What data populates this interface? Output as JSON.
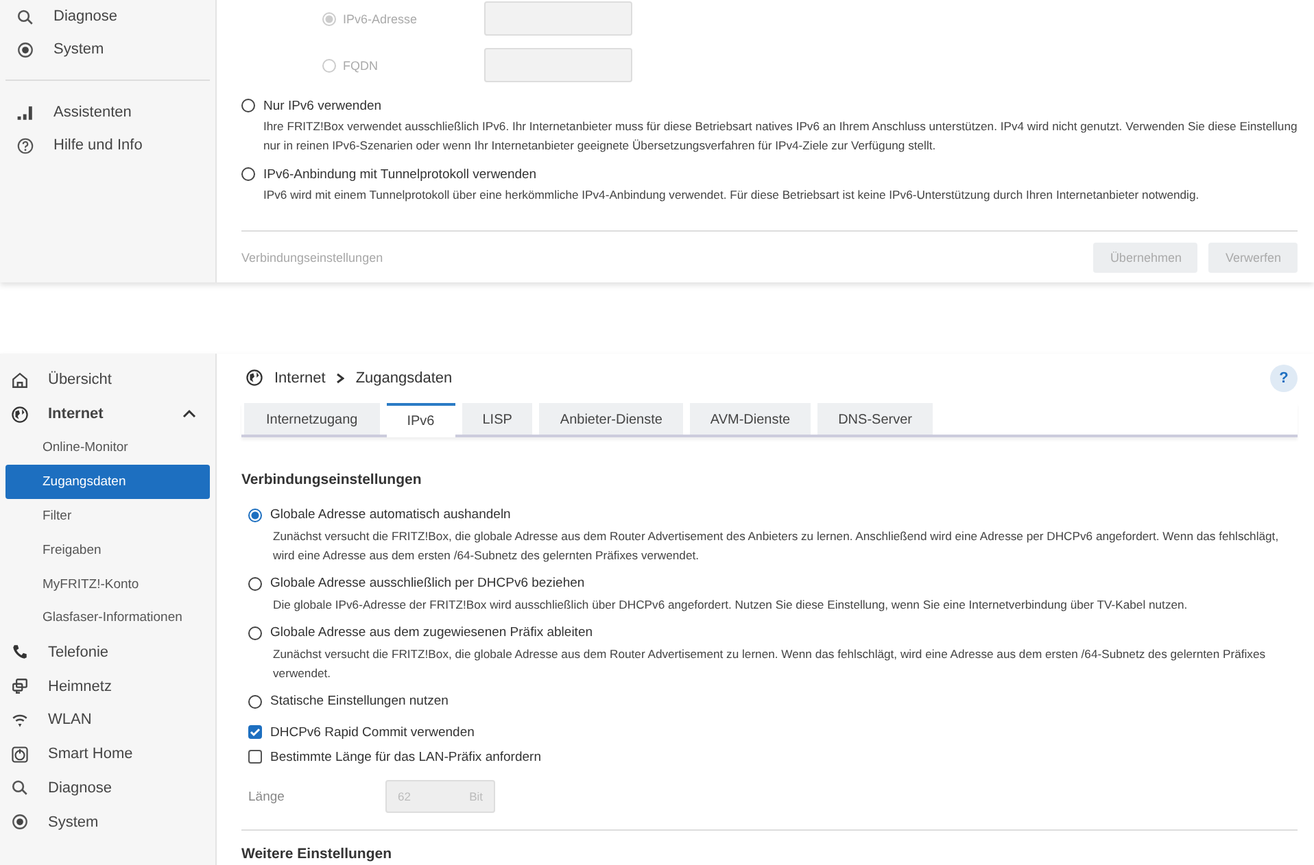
{
  "top_panel": {
    "sidebar": {
      "groups": [
        {
          "items": [
            {
              "label": "Diagnose",
              "kind": "diagnose"
            },
            {
              "label": "System",
              "kind": "system"
            }
          ]
        },
        {
          "items": [
            {
              "label": "Assistenten",
              "kind": "assistant"
            },
            {
              "label": "Hilfe und Info",
              "kind": "help"
            }
          ]
        }
      ]
    },
    "sub_options": [
      {
        "label": "IPv6-Adresse",
        "selected": true,
        "disabled": true
      },
      {
        "label": "FQDN",
        "selected": false,
        "disabled": true
      }
    ],
    "options": [
      {
        "label": "Nur IPv6 verwenden",
        "selected": false,
        "description": "Ihre FRITZ!Box verwendet ausschließlich IPv6. Ihr Internetanbieter muss für diese Betriebsart natives IPv6 an Ihrem Anschluss unterstützen. IPv4 wird nicht genutzt. Verwenden Sie diese Einstellung nur in reinen IPv6-Szenarien oder wenn Ihr Internetanbieter geeignete Übersetzungsverfahren für IPv4-Ziele zur Verfügung stellt."
      },
      {
        "label": "IPv6-Anbindung mit Tunnelprotokoll verwenden",
        "selected": false,
        "description": "IPv6 wird mit einem Tunnelprotokoll über eine herkömmliche IPv4-Anbindung verwendet. Für diese Betriebsart ist keine IPv6-Unterstützung durch Ihren Internetanbieter notwendig."
      }
    ],
    "footer": {
      "label": "Verbindungseinstellungen",
      "buttons": [
        {
          "label": "Übernehmen",
          "disabled": true
        },
        {
          "label": "Verwerfen",
          "disabled": true
        }
      ]
    }
  },
  "bottom_panel": {
    "sidebar": {
      "items": [
        {
          "label": "Übersicht",
          "kind": "home"
        },
        {
          "label": "Internet",
          "kind": "internet",
          "expanded": true,
          "children": [
            {
              "label": "Online-Monitor",
              "selected": false
            },
            {
              "label": "Zugangsdaten",
              "selected": true
            },
            {
              "label": "Filter",
              "selected": false
            },
            {
              "label": "Freigaben",
              "selected": false
            },
            {
              "label": "MyFRITZ!-Konto",
              "selected": false
            },
            {
              "label": "Glasfaser-Informationen",
              "selected": false
            }
          ]
        },
        {
          "label": "Telefonie",
          "kind": "phone"
        },
        {
          "label": "Heimnetz",
          "kind": "network"
        },
        {
          "label": "WLAN",
          "kind": "wifi"
        },
        {
          "label": "Smart Home",
          "kind": "smarthome"
        },
        {
          "label": "Diagnose",
          "kind": "diagnose"
        },
        {
          "label": "System",
          "kind": "system"
        }
      ]
    },
    "breadcrumb": [
      "Internet",
      "Zugangsdaten"
    ],
    "help_button": "?",
    "tabs": [
      {
        "label": "Internetzugang",
        "selected": false
      },
      {
        "label": "IPv6",
        "selected": true
      },
      {
        "label": "LISP",
        "selected": false
      },
      {
        "label": "Anbieter-Dienste",
        "selected": false
      },
      {
        "label": "AVM-Dienste",
        "selected": false
      },
      {
        "label": "DNS-Server",
        "selected": false
      }
    ],
    "section_title": "Verbindungseinstellungen",
    "options": [
      {
        "label": "Globale Adresse automatisch aushandeln",
        "selected": true,
        "description": "Zunächst versucht die FRITZ!Box, die globale Adresse aus dem Router Advertisement des Anbieters zu lernen. Anschließend wird eine Adresse per DHCPv6 angefordert. Wenn das fehlschlägt, wird eine Adresse aus dem ersten /64-Subnetz des gelernten Präfixes verwendet."
      },
      {
        "label": "Globale Adresse ausschließlich per DHCPv6 beziehen",
        "selected": false,
        "description": "Die globale IPv6-Adresse der FRITZ!Box wird ausschließlich über DHCPv6 angefordert. Nutzen Sie diese Einstellung, wenn Sie eine Internetverbindung über TV-Kabel nutzen."
      },
      {
        "label": "Globale Adresse aus dem zugewiesenen Präfix ableiten",
        "selected": false,
        "description": "Zunächst versucht die FRITZ!Box, die globale Adresse aus dem Router Advertisement zu lernen. Wenn das fehlschlägt, wird eine Adresse aus dem ersten /64-Subnetz des gelernten Präfixes verwendet."
      },
      {
        "label": "Statische Einstellungen nutzen",
        "selected": false
      }
    ],
    "checkboxes": [
      {
        "label": "DHCPv6 Rapid Commit verwenden",
        "checked": true
      },
      {
        "label": "Bestimmte Länge für das LAN-Präfix anfordern",
        "checked": false
      }
    ],
    "length_field": {
      "label": "Länge",
      "value": "62",
      "unit": "Bit",
      "disabled": true
    },
    "next_section_title": "Weitere Einstellungen"
  }
}
